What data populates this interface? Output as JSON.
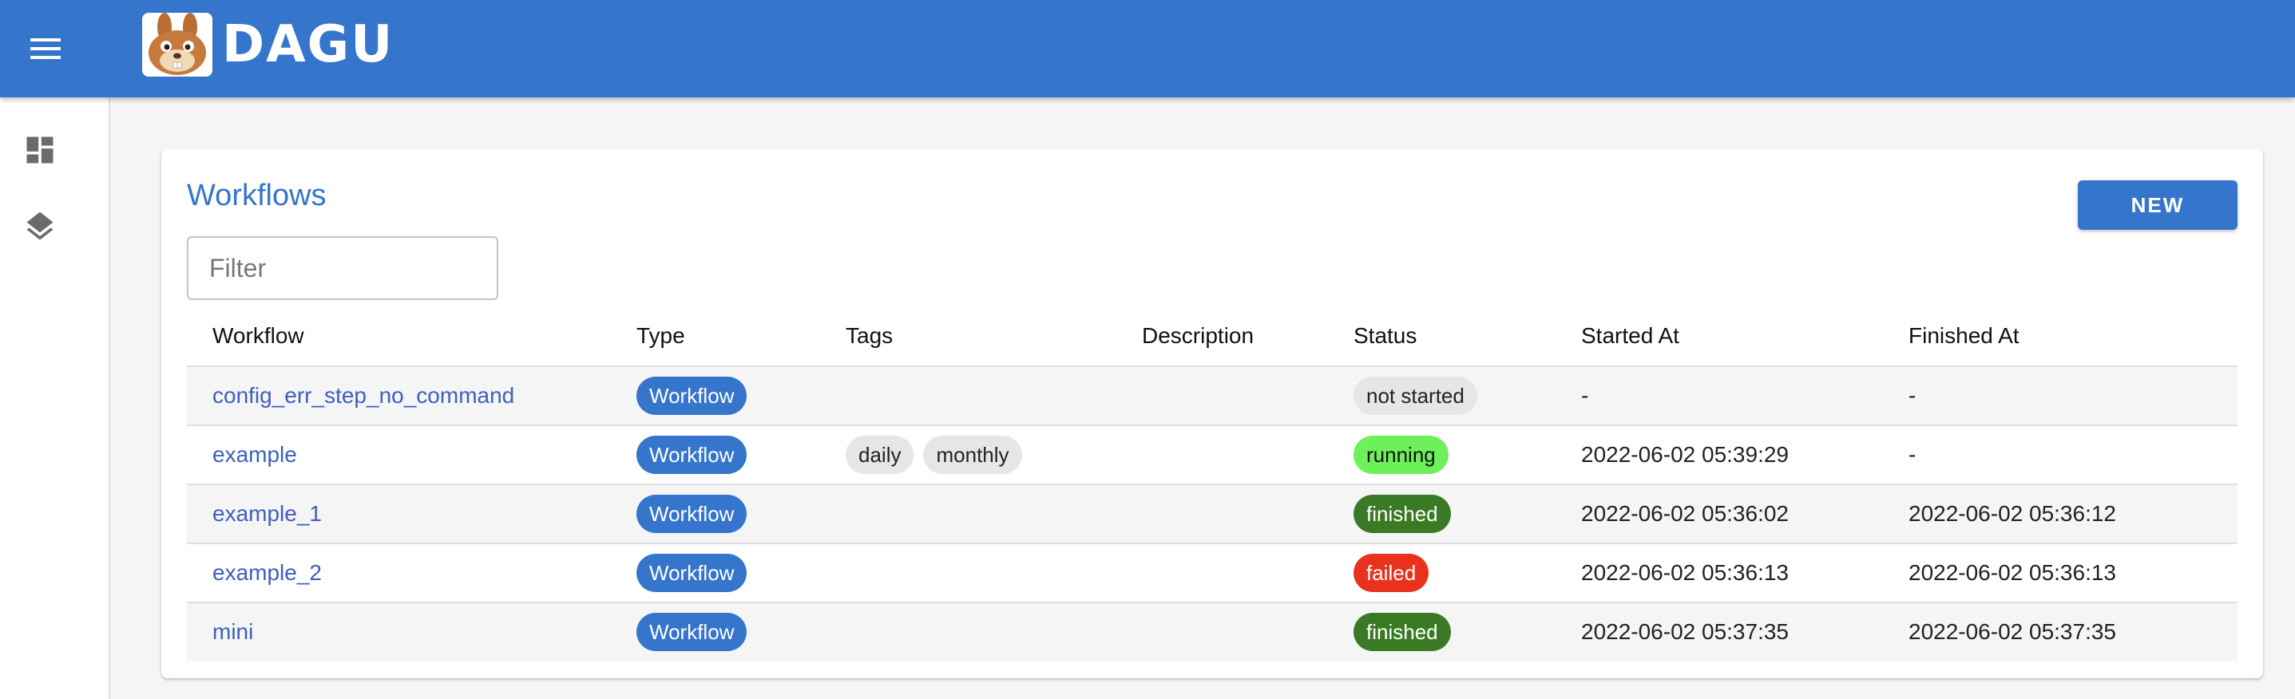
{
  "app": {
    "logo_text": "DAGU"
  },
  "sidebar": {
    "items": [
      {
        "icon": "dashboard-icon"
      },
      {
        "icon": "layers-icon"
      }
    ]
  },
  "main": {
    "title": "Workflows",
    "new_button": "NEW",
    "filter_placeholder": "Filter",
    "columns": [
      "Workflow",
      "Type",
      "Tags",
      "Description",
      "Status",
      "Started At",
      "Finished At"
    ],
    "rows": [
      {
        "name": "config_err_step_no_command",
        "type": "Workflow",
        "tags": [],
        "description": "",
        "status": "not started",
        "started_at": "-",
        "finished_at": "-"
      },
      {
        "name": "example",
        "type": "Workflow",
        "tags": [
          "daily",
          "monthly"
        ],
        "description": "",
        "status": "running",
        "started_at": "2022-06-02 05:39:29",
        "finished_at": "-"
      },
      {
        "name": "example_1",
        "type": "Workflow",
        "tags": [],
        "description": "",
        "status": "finished",
        "started_at": "2022-06-02 05:36:02",
        "finished_at": "2022-06-02 05:36:12"
      },
      {
        "name": "example_2",
        "type": "Workflow",
        "tags": [],
        "description": "",
        "status": "failed",
        "started_at": "2022-06-02 05:36:13",
        "finished_at": "2022-06-02 05:36:13"
      },
      {
        "name": "mini",
        "type": "Workflow",
        "tags": [],
        "description": "",
        "status": "finished",
        "started_at": "2022-06-02 05:37:35",
        "finished_at": "2022-06-02 05:37:35"
      }
    ]
  },
  "colors": {
    "primary": "#3575cc",
    "status_not_started": "#e6e6e6",
    "status_running": "#6ef05a",
    "status_finished": "#3b7a24",
    "status_failed": "#e8321e"
  }
}
